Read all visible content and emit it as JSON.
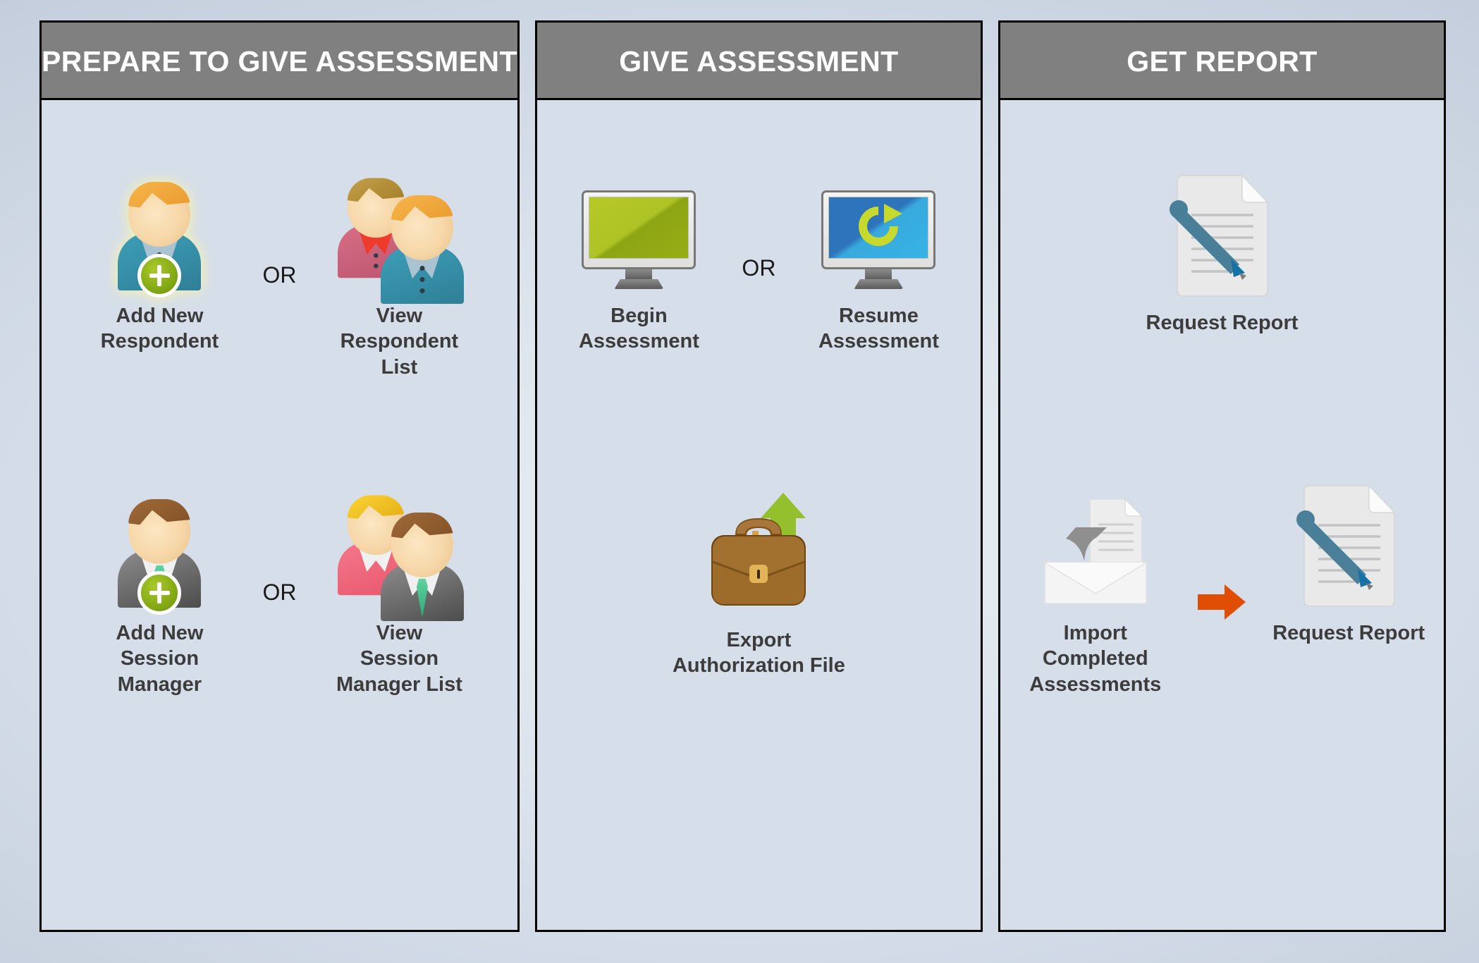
{
  "columns": [
    {
      "id": "prepare",
      "header": "PREPARE TO GIVE ASSESSMENT",
      "rows": [
        {
          "separator": "OR",
          "items": [
            {
              "icon": "add-new-respondent-icon",
              "label": "Add New\nRespondent"
            },
            {
              "icon": "view-respondent-list-icon",
              "label": "View\nRespondent\nList"
            }
          ]
        },
        {
          "separator": "OR",
          "items": [
            {
              "icon": "add-new-session-manager-icon",
              "label": "Add New\nSession\nManager"
            },
            {
              "icon": "view-session-manager-list-icon",
              "label": "View\nSession\nManager List"
            }
          ]
        }
      ]
    },
    {
      "id": "give",
      "header": "GIVE ASSESSMENT",
      "rows": [
        {
          "separator": "OR",
          "items": [
            {
              "icon": "begin-assessment-icon",
              "label": "Begin\nAssessment"
            },
            {
              "icon": "resume-assessment-icon",
              "label": "Resume\nAssessment"
            }
          ]
        },
        {
          "separator": "",
          "items": [
            {
              "icon": "export-authorization-file-icon",
              "label": "Export\nAuthorization File"
            }
          ]
        }
      ]
    },
    {
      "id": "report",
      "header": "GET REPORT",
      "rows": [
        {
          "separator": "",
          "items": [
            {
              "icon": "request-report-icon",
              "label": "Request Report"
            }
          ]
        },
        {
          "separator": "arrow-right",
          "items": [
            {
              "icon": "import-completed-assessments-icon",
              "label": "Import\nCompleted\nAssessments"
            },
            {
              "icon": "request-report-icon",
              "label": "Request Report"
            }
          ]
        }
      ]
    }
  ],
  "colors": {
    "header_bg": "#808080",
    "header_text": "#ffffff",
    "panel_bg": "#d6dfe9",
    "panel_border": "#000000",
    "label_text": "#3c3c3c",
    "arrow_orange": "#e04e06",
    "accent_green": "#8fb316",
    "accent_blue": "#4a7f99"
  }
}
